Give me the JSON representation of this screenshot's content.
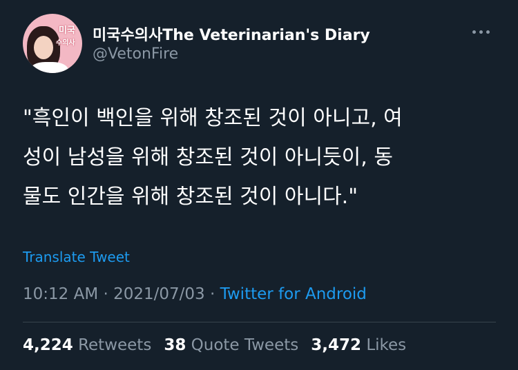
{
  "author": {
    "display_name": "미국수의사The Veterinarian's Diary",
    "handle": "@VetonFire",
    "avatar_text_line1": "미국",
    "avatar_text_line2": "수의사"
  },
  "tweet": {
    "text_lines": [
      "\"흑인이 백인을 위해 창조된 것이 아니고, 여",
      "성이 남성을 위해 창조된 것이 아니듯이, 동",
      "물도 인간을 위해 창조된 것이 아니다.\""
    ],
    "translate_label": "Translate Tweet",
    "time": "10:12 AM",
    "separator": "·",
    "date": "2021/07/03",
    "source": "Twitter for Android"
  },
  "stats": {
    "retweets_count": "4,224",
    "retweets_label": "Retweets",
    "quote_count": "38",
    "quote_label": "Quote Tweets",
    "likes_count": "3,472",
    "likes_label": "Likes"
  },
  "icons": {
    "more": "more-horizontal-icon"
  },
  "colors": {
    "background": "#15202b",
    "accent": "#1d9bf0",
    "secondary_text": "#8b98a5"
  }
}
